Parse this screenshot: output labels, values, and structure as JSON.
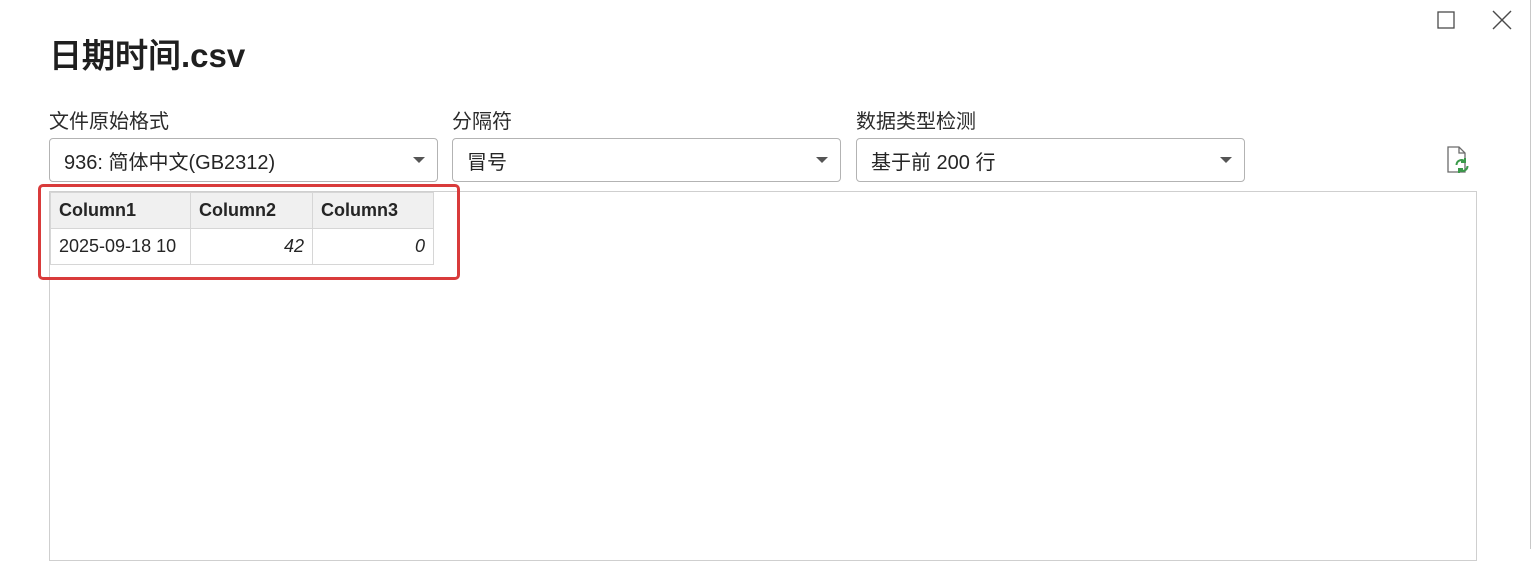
{
  "dialog": {
    "title": "日期时间.csv",
    "maximize_icon": "maximize-icon",
    "close_icon": "close-icon"
  },
  "options": {
    "file_origin": {
      "label": "文件原始格式",
      "value": "936: 简体中文(GB2312)"
    },
    "delimiter": {
      "label": "分隔符",
      "value": "冒号"
    },
    "data_type_detection": {
      "label": "数据类型检测",
      "value": "基于前 200 行"
    },
    "refresh_icon": "refresh-document-icon"
  },
  "preview": {
    "columns": [
      "Column1",
      "Column2",
      "Column3"
    ],
    "rows": [
      [
        "2025-09-18 10",
        "42",
        "0"
      ]
    ]
  },
  "colors": {
    "highlight": "#d93b3b",
    "refresh_accent": "#3a9a4a"
  }
}
